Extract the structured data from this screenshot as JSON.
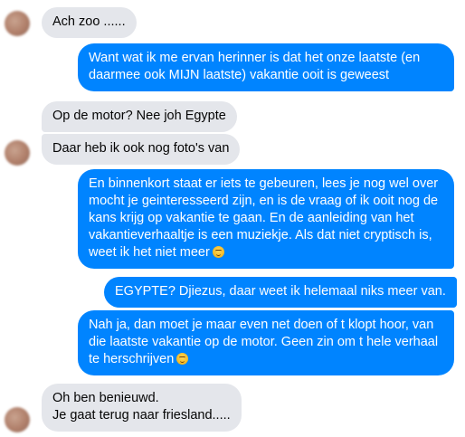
{
  "thread": {
    "messages": [
      {
        "id": "m1",
        "direction": "incoming",
        "text": "Ach zoo ......"
      },
      {
        "id": "m2",
        "direction": "outgoing",
        "text": "Want wat ik me ervan herinner is dat het onze laatste (en daarmee ook MIJN laatste) vakantie ooit is geweest"
      },
      {
        "id": "m3",
        "direction": "incoming",
        "text": "Op de motor? Nee joh Egypte"
      },
      {
        "id": "m4",
        "direction": "incoming",
        "text": "Daar heb ik ook nog foto's van"
      },
      {
        "id": "m5",
        "direction": "outgoing",
        "text": "En binnenkort staat er iets te gebeuren, lees je nog wel over mocht je geinteresseerd zijn, en is de vraag of ik ooit nog de kans krijg op vakantie te gaan. En de aanleiding van het vakantieverhaaltje is een muziekje. Als dat niet cryptisch is, weet ik het niet meer",
        "emoji": "wink-emoji"
      },
      {
        "id": "m6",
        "direction": "outgoing",
        "text": "EGYPTE? Djiezus, daar weet ik helemaal niks meer van."
      },
      {
        "id": "m7",
        "direction": "outgoing",
        "text": "Nah ja, dan moet je maar even net doen of t klopt hoor, van die laatste vakantie op de motor. Geen zin om t hele verhaal te herschrijven",
        "emoji": "wink-emoji"
      },
      {
        "id": "m8",
        "direction": "incoming",
        "lines": [
          "Oh ben benieuwd.",
          "Je gaat terug naar friesland....."
        ]
      }
    ]
  },
  "colors": {
    "incoming_bubble": "#e4e6eb",
    "outgoing_bubble": "#0084ff",
    "outgoing_text": "#ffffff",
    "incoming_text": "#050505"
  }
}
